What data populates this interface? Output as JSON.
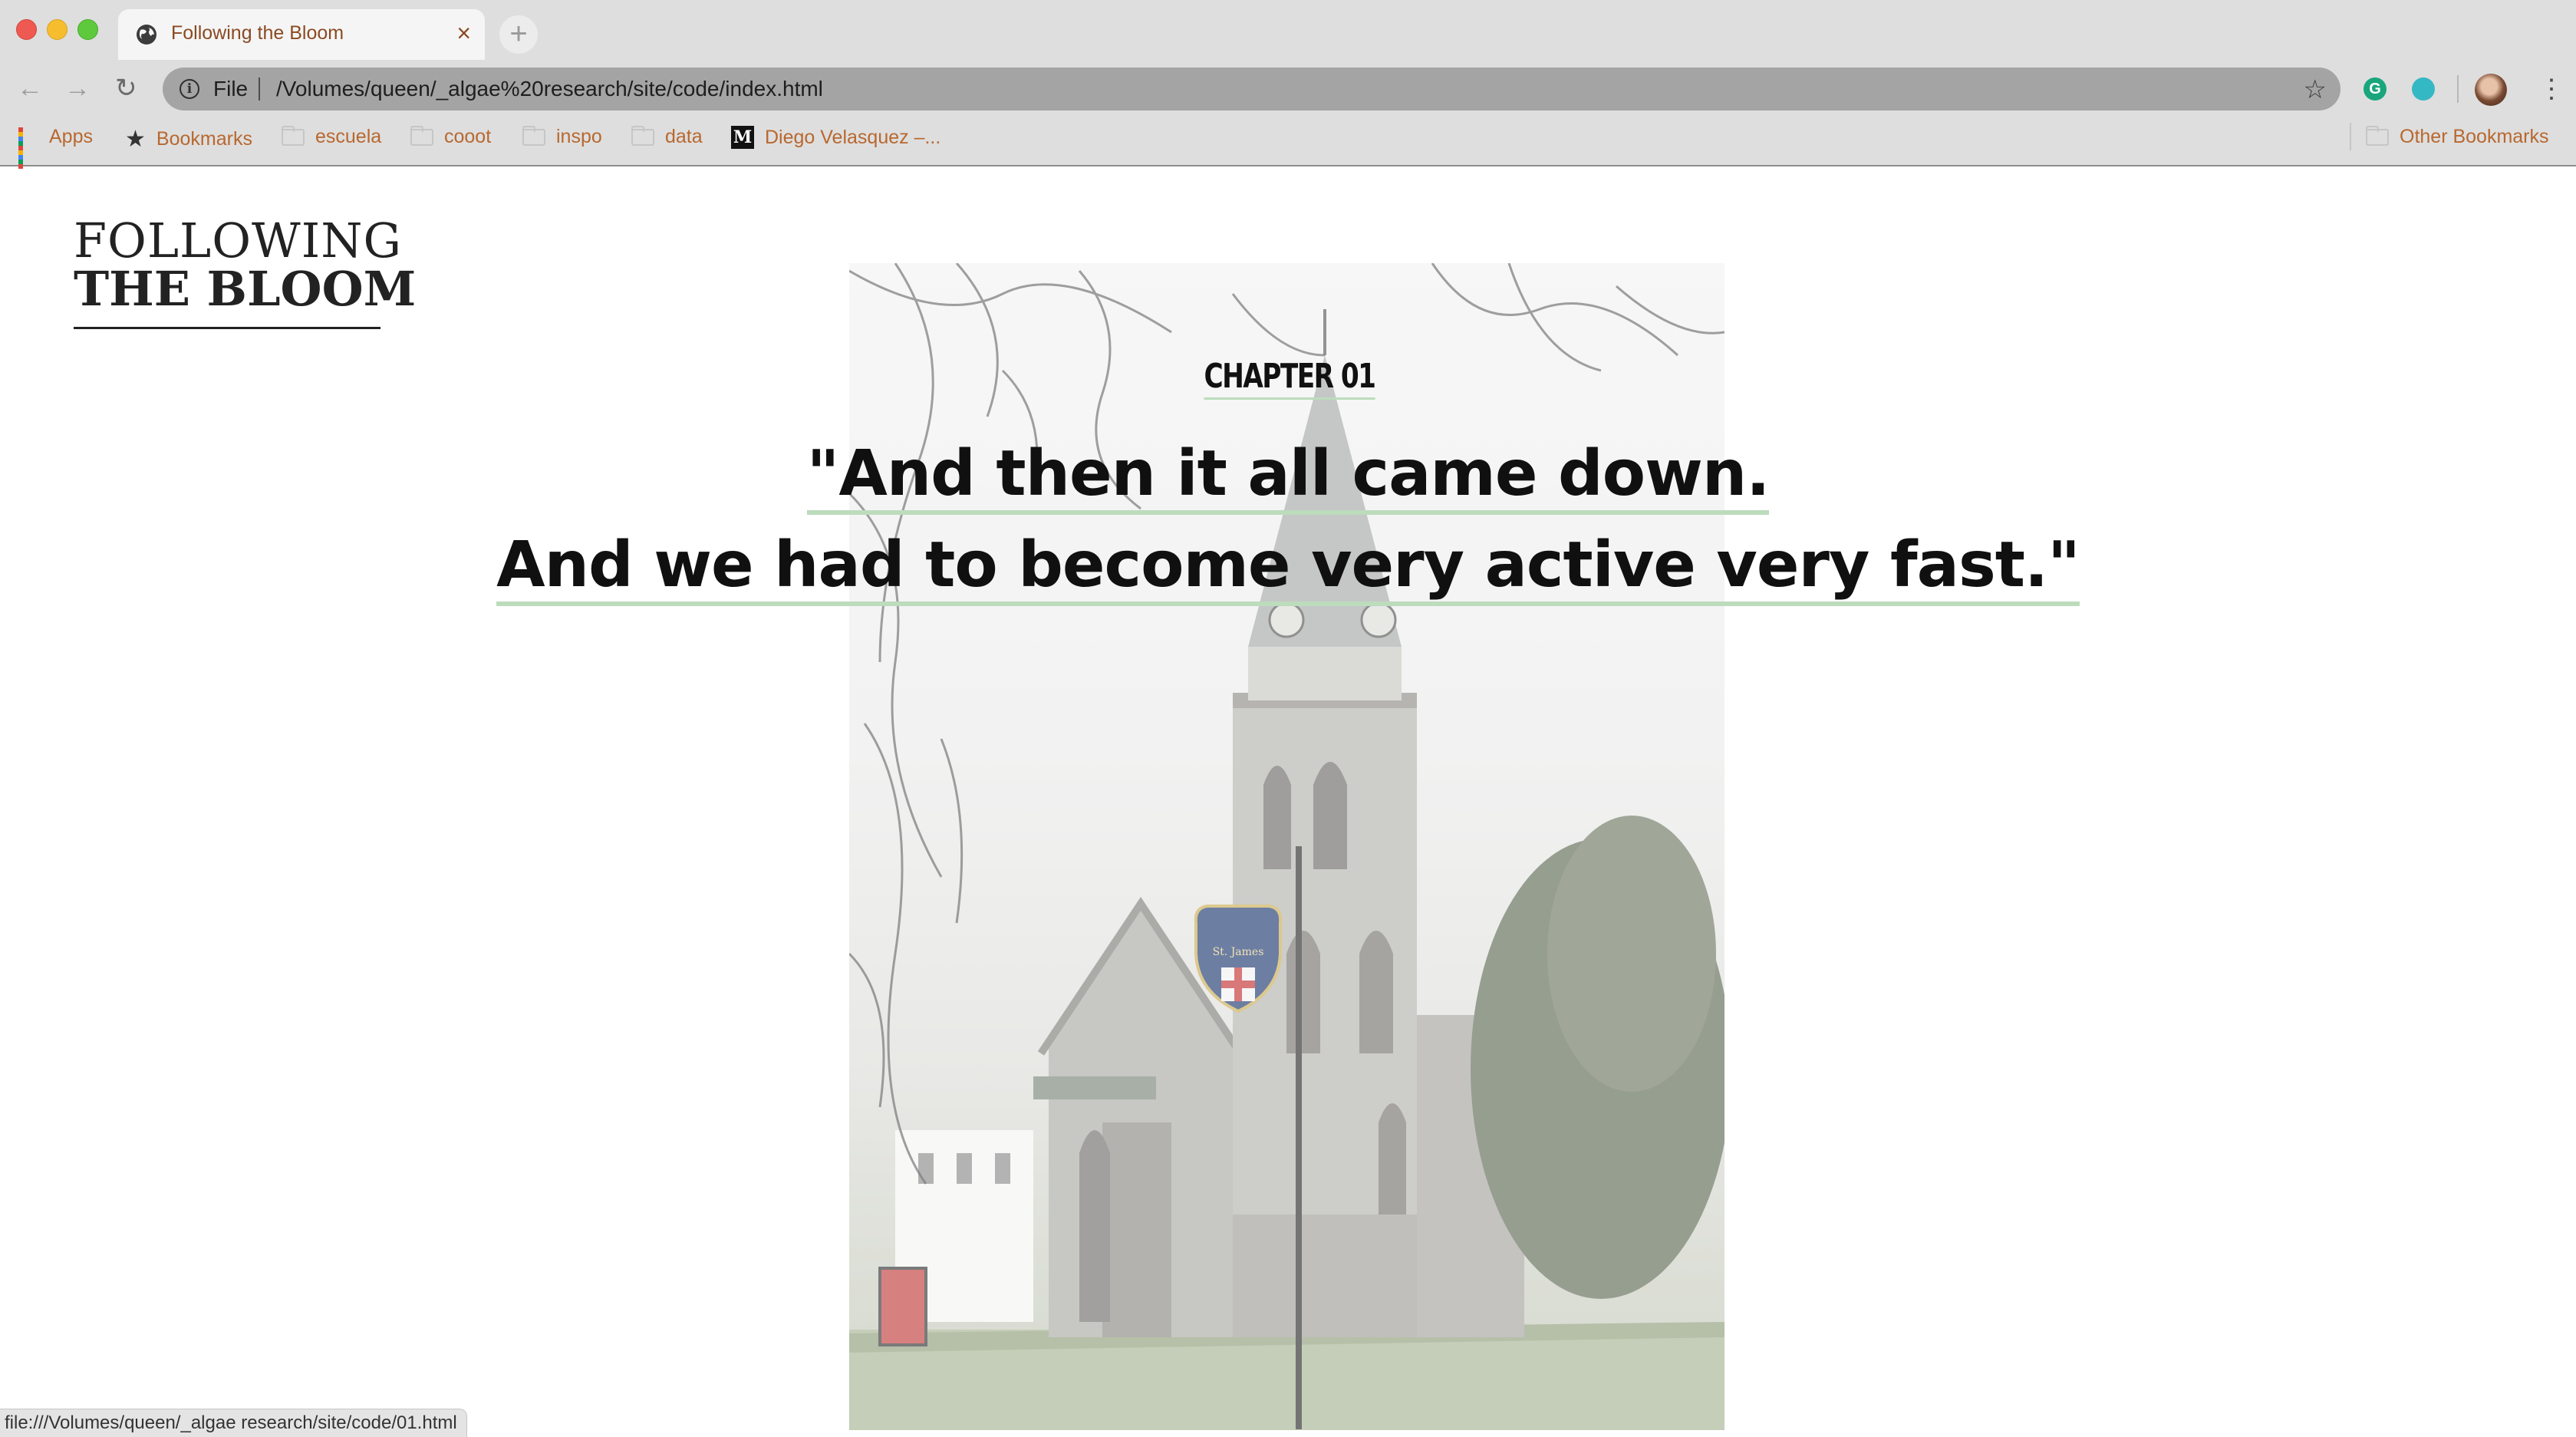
{
  "browser": {
    "tab": {
      "title": "Following the Bloom",
      "close": "×"
    },
    "new_tab": "+",
    "nav": {
      "back": "←",
      "forward": "→",
      "reload": "↻"
    },
    "address": {
      "scheme": "File",
      "url": "/Volumes/queen/_algae%20research/site/code/index.html",
      "info": "i"
    },
    "extensions": {
      "grammarly": "G"
    },
    "menu": "⋮",
    "bookmarks": [
      {
        "label": "Apps",
        "icon": "apps-grid-icon"
      },
      {
        "label": "Bookmarks",
        "icon": "star-icon"
      },
      {
        "label": "escuela",
        "icon": "folder-icon"
      },
      {
        "label": "cooot",
        "icon": "folder-icon"
      },
      {
        "label": "inspo",
        "icon": "folder-icon"
      },
      {
        "label": "data",
        "icon": "folder-icon"
      },
      {
        "label": "Diego Velasquez –...",
        "icon": "medium-icon"
      }
    ],
    "other_bookmarks": "Other Bookmarks",
    "status_url": "file:///Volumes/queen/_algae research/site/code/01.html"
  },
  "page": {
    "logo": {
      "line1": "FOLLOWING",
      "line2": "THE BLOOM"
    },
    "chapter": "CHAPTER 01",
    "quote_line1": "\"And then it all came down.",
    "quote_line2": "And we had to become very active very fast.\"",
    "hero_image": "church-photo",
    "sign_text": "St. James",
    "accent_underline": "#bcdcbc"
  }
}
